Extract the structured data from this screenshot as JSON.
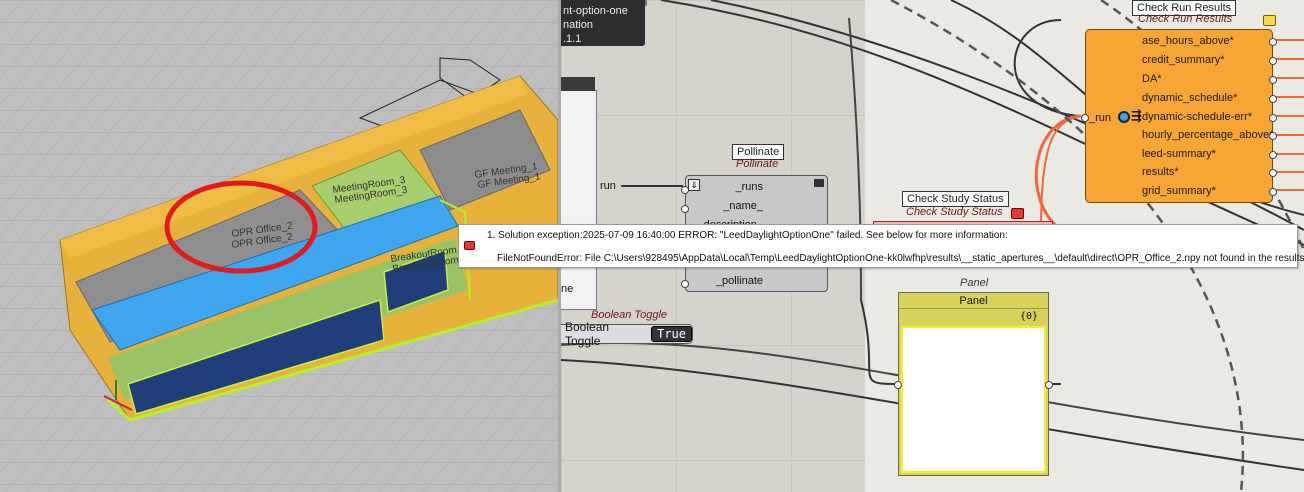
{
  "viewport": {
    "rooms": {
      "opr_office": "OPR Office_2",
      "opr_office_under": "OPR Office_2",
      "meeting_room": "MeetingRoom_3",
      "meeting_room_under": "MeetingRoom_3",
      "gf_meeting": "GF Meeting_1",
      "gf_meeting_under": "GF Meeting_1",
      "breakout_room": "BreakoutRoom",
      "breakout_room_under": "BreakoutRoom"
    },
    "highlight_color": "#e11b1b"
  },
  "canvas": {
    "info_box": {
      "line1": "nt-option-one",
      "line2": "nation",
      "line3": ".1.1"
    },
    "left_component": {
      "run_label": "run",
      "cut_label": "ne"
    },
    "boolean_toggle": {
      "sublabel": "Boolean Toggle",
      "label": "Boolean Toggle",
      "value": "True"
    },
    "pollinate": {
      "label": "Pollinate",
      "sublabel": "Pollinate",
      "inputs": [
        "_runs",
        "_name_",
        "description_",
        "",
        "",
        "_pollinate"
      ]
    },
    "check_run_results": {
      "label": "Check Run Results",
      "sublabel": "Check Run Results",
      "input": "_run",
      "outputs": [
        "ase_hours_above*",
        "credit_summary*",
        "DA*",
        "dynamic_schedule*",
        "dynamic-schedule-err*",
        "hourly_percentage_above*",
        "leed-summary*",
        "results*",
        "grid_summary*"
      ],
      "accent": "#f7a534"
    },
    "check_study_status": {
      "label": "Check Study Status",
      "sublabel": "Check Study Status"
    },
    "panel": {
      "sublabel": "Panel",
      "label": "Panel",
      "count": "{0}"
    },
    "error": {
      "line1": "1. Solution exception:2025-07-09 16:40:00 ERROR: \"LeedDaylightOptionOne\" failed. See below for more information:",
      "line2": "FileNotFoundError: File C:\\Users\\928495\\AppData\\Local\\Temp\\LeedDaylightOptionOne-kk0lwfhp\\results\\__static_apertures__\\default\\direct\\OPR_Office_2.npy not found in the results folder.",
      "icon": "error-icon",
      "color": "#e53935"
    }
  }
}
